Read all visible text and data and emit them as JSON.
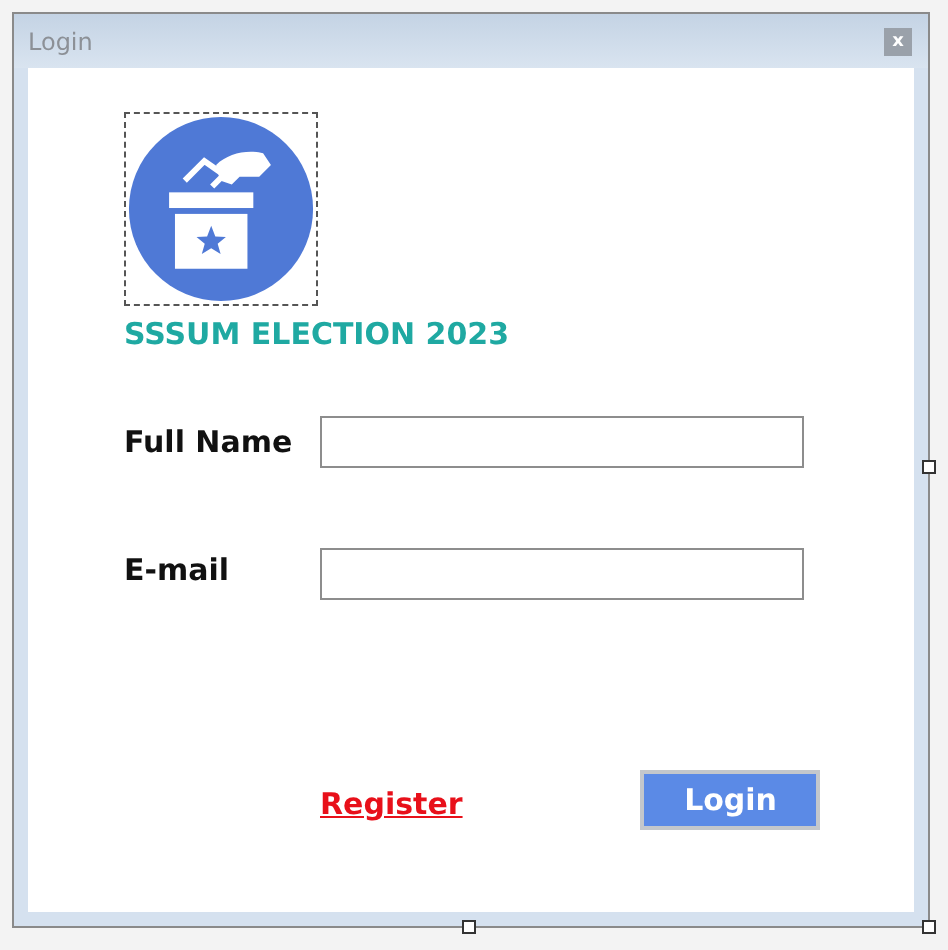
{
  "window": {
    "title": "Login",
    "close": "x"
  },
  "heading": "SSSUM ELECTION 2023",
  "fields": [
    {
      "label": "Full Name"
    },
    {
      "label": "E-mail"
    }
  ],
  "link": "Register",
  "button": "Login"
}
